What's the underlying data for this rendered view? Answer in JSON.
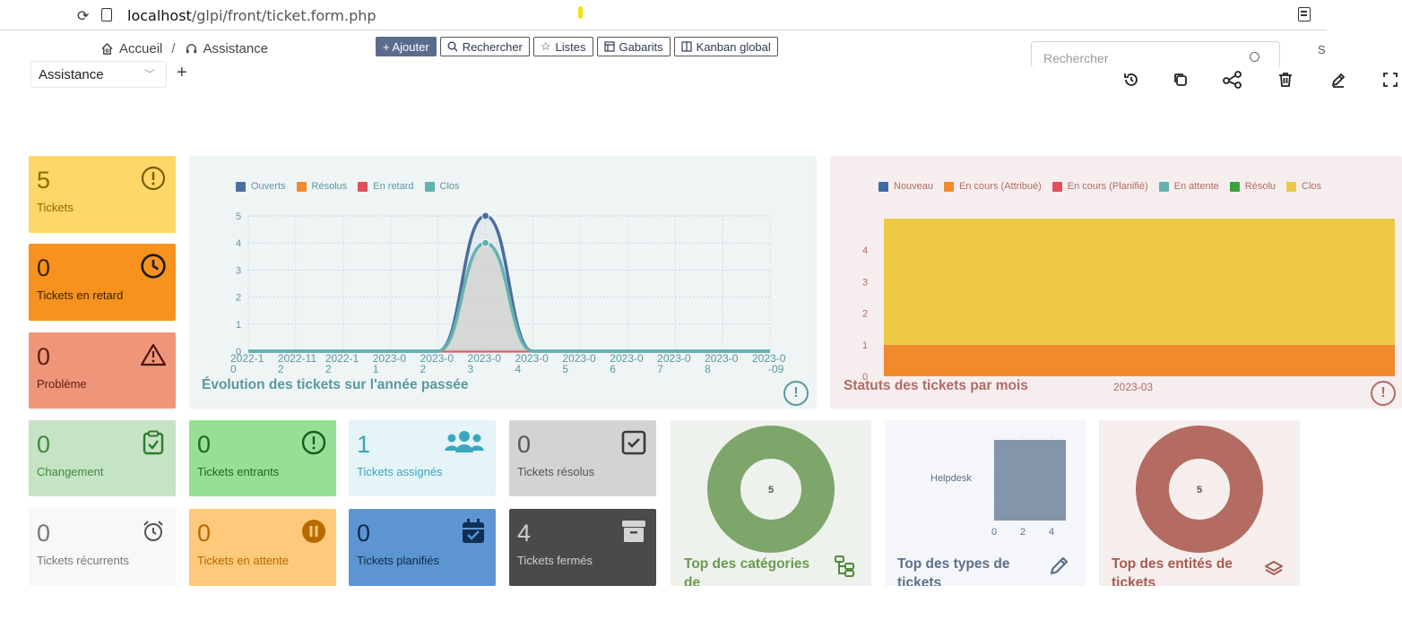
{
  "browser": {
    "url_host": "localhost",
    "url_path": "/glpi/front/ticket.form.php"
  },
  "breadcrumb": {
    "home": "Accueil",
    "separator": "/",
    "section": "Assistance"
  },
  "toolbar": {
    "add": "+ Ajouter",
    "search": "Rechercher",
    "lists": "Listes",
    "templates": "Gabarits",
    "kanban": "Kanban global"
  },
  "global_search": {
    "placeholder": "Rechercher",
    "edge": "S"
  },
  "dashboard_selector": {
    "value": "Assistance",
    "add": "+"
  },
  "cards": {
    "tickets": {
      "value": "5",
      "label": "Tickets"
    },
    "late": {
      "value": "0",
      "label": "Tickets en retard"
    },
    "problem": {
      "value": "0",
      "label": "Problème"
    },
    "change": {
      "value": "0",
      "label": "Changement"
    },
    "incoming": {
      "value": "0",
      "label": "Tickets entrants"
    },
    "assigned": {
      "value": "1",
      "label": "Tickets assignés"
    },
    "solved": {
      "value": "0",
      "label": "Tickets résolus"
    },
    "recurrent": {
      "value": "0",
      "label": "Tickets récurrents"
    },
    "waiting": {
      "value": "0",
      "label": "Tickets en attente"
    },
    "planned": {
      "value": "0",
      "label": "Tickets planifiés"
    },
    "closed": {
      "value": "4",
      "label": "Tickets fermés"
    }
  },
  "evolution": {
    "title": "Évolution des tickets sur l'année passée",
    "legend": [
      {
        "name": "Ouverts",
        "color": "#4a6ea0"
      },
      {
        "name": "Résolus",
        "color": "#f08a2c"
      },
      {
        "name": "En retard",
        "color": "#e0505a"
      },
      {
        "name": "Clos",
        "color": "#62b2b0"
      }
    ]
  },
  "status": {
    "title": "Statuts des tickets par mois",
    "legend": [
      {
        "name": "Nouveau",
        "color": "#3f6aa6"
      },
      {
        "name": "En cours (Attribué)",
        "color": "#f08a2c"
      },
      {
        "name": "En cours (Planifié)",
        "color": "#e0505a"
      },
      {
        "name": "En attente",
        "color": "#62b2b0"
      },
      {
        "name": "Résolu",
        "color": "#3aa040"
      },
      {
        "name": "Clos",
        "color": "#ecc845"
      }
    ]
  },
  "categories": {
    "title": "Top des catégories de",
    "center": "5"
  },
  "types": {
    "title": "Top des types de tickets",
    "bar_label": "Helpdesk"
  },
  "entities": {
    "title": "Top des entités de tickets",
    "center": "5"
  },
  "chart_data": [
    {
      "type": "line",
      "title": "Évolution des tickets sur l'année passée",
      "x": [
        "2022-10",
        "2022-11",
        "2022-12",
        "2023-02",
        "2023-02",
        "2023-03",
        "2023-04",
        "2023-05",
        "2023-06",
        "2023-07",
        "2023-08",
        "2023-09"
      ],
      "x_ticks": [
        [
          "2022-1",
          "0"
        ],
        [
          "2022-11",
          "2"
        ],
        [
          "2022-1",
          "2"
        ],
        [
          "2023-0",
          "1"
        ],
        [
          "2023-0",
          "2"
        ],
        [
          "2023-0",
          "3"
        ],
        [
          "2023-0",
          "4"
        ],
        [
          "2023-0",
          "5"
        ],
        [
          "2023-0",
          "6"
        ],
        [
          "2023-0",
          "7"
        ],
        [
          "2023-0",
          "8"
        ],
        [
          "2023-0",
          "-09"
        ]
      ],
      "ylim": [
        0,
        5
      ],
      "y_ticks": [
        "0",
        "1",
        "2",
        "3",
        "4",
        "5"
      ],
      "series": [
        {
          "name": "Ouverts",
          "values": [
            0,
            0,
            0,
            0,
            0,
            5,
            0,
            0,
            0,
            0,
            0,
            0
          ]
        },
        {
          "name": "Résolus",
          "values": [
            0,
            0,
            0,
            0,
            0,
            0,
            0,
            0,
            0,
            0,
            0,
            0
          ]
        },
        {
          "name": "En retard",
          "values": [
            0,
            0,
            0,
            0,
            0,
            0,
            0,
            0,
            0,
            0,
            0,
            0
          ]
        },
        {
          "name": "Clos",
          "values": [
            0,
            0,
            0,
            0,
            0,
            4,
            0,
            0,
            0,
            0,
            0,
            0
          ]
        }
      ],
      "grid": true
    },
    {
      "type": "bar",
      "stacked": true,
      "title": "Statuts des tickets par mois",
      "categories": [
        "2023-03"
      ],
      "ylim": [
        0,
        5
      ],
      "y_ticks": [
        "0",
        "1",
        "2",
        "3",
        "4"
      ],
      "series": [
        {
          "name": "En cours (Attribué)",
          "values": [
            1
          ]
        },
        {
          "name": "Clos",
          "values": [
            4
          ]
        }
      ]
    },
    {
      "type": "pie",
      "title": "Top des catégories de",
      "labels": [
        "5"
      ],
      "values": [
        5
      ],
      "colors": [
        "#7ea56a"
      ]
    },
    {
      "type": "bar",
      "orientation": "horizontal",
      "title": "Top des types de tickets",
      "categories": [
        "Helpdesk"
      ],
      "values": [
        5
      ],
      "xlim": [
        0,
        5
      ],
      "x_ticks": [
        "0",
        "2",
        "4"
      ]
    },
    {
      "type": "pie",
      "title": "Top des entités de tickets",
      "labels": [
        "5"
      ],
      "values": [
        5
      ],
      "colors": [
        "#b36b62"
      ]
    }
  ]
}
